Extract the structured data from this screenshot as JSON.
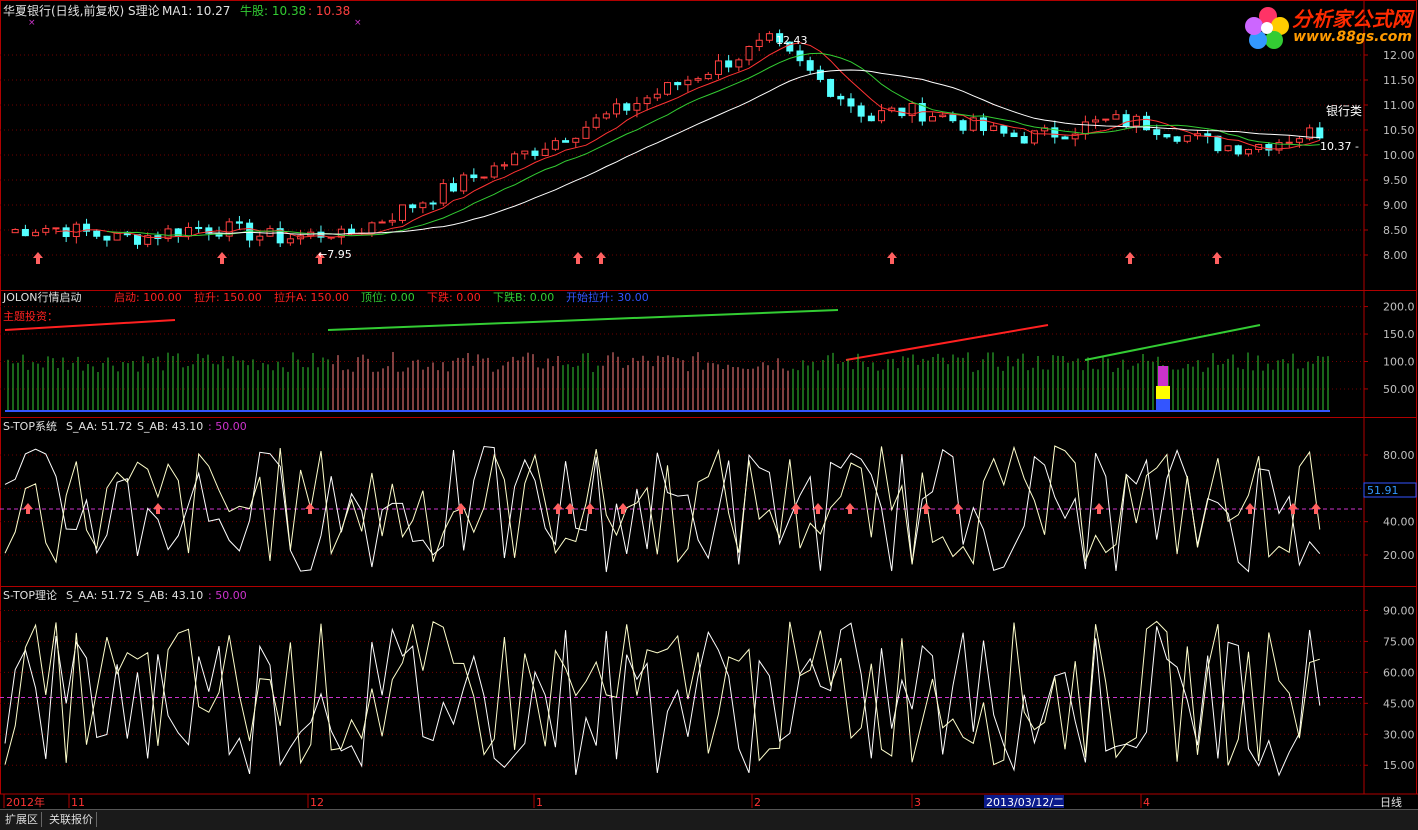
{
  "panels": {
    "main": {
      "title": "华夏银行(日线,前复权) S理论",
      "ma_label": "MA1: 10.27",
      "bull_label": "牛股: 10.38",
      "bull_value2": ": 10.38",
      "right_label": "银行类",
      "price_tag": "10.37",
      "high_label": "12.43",
      "low_label": "7.95",
      "ticks": [
        "12.00",
        "11.50",
        "11.00",
        "10.50",
        "10.00",
        "9.50",
        "9.00",
        "8.50",
        "8.00"
      ]
    },
    "jolon": {
      "title": "JOLON行情启动",
      "items": [
        {
          "text": "启动: 100.00",
          "color": "#ff2020"
        },
        {
          "text": "拉升: 150.00",
          "color": "#ff2020"
        },
        {
          "text": "拉升A: 150.00",
          "color": "#ff2020"
        },
        {
          "text": "顶位: 0.00",
          "color": "#33cc33"
        },
        {
          "text": "下跌: 0.00",
          "color": "#ff2020"
        },
        {
          "text": "下跌B: 0.00",
          "color": "#33cc33"
        },
        {
          "text": "开始拉升: 30.00",
          "color": "#3355ff"
        }
      ],
      "subtitle": "主题投资：",
      "ticks": [
        "200.0",
        "150.0",
        "100.0",
        "50.00"
      ]
    },
    "stop1": {
      "title": "S-TOP系统",
      "saa": "S_AA: 51.72",
      "sab": "S_AB: 43.10",
      "level": ": 50.00",
      "value_tag": "51.91",
      "ticks": [
        "80.00",
        "60.00",
        "40.00",
        "20.00"
      ]
    },
    "stop2": {
      "title": "S-TOP理论",
      "saa": "S_AA: 51.72",
      "sab": "S_AB: 43.10",
      "level": ": 50.00",
      "ticks": [
        "90.00",
        "75.00",
        "60.00",
        "45.00",
        "30.00",
        "15.00"
      ]
    }
  },
  "time_axis": {
    "labels": [
      "2012年",
      "11",
      "12",
      "1",
      "2",
      "3",
      "4"
    ],
    "cursor_date": "2013/03/12/二",
    "period": "日线"
  },
  "logo": {
    "name": "分析家公式网",
    "url": "www.88gs.com"
  },
  "tabs": [
    "扩展区",
    "关联报价"
  ],
  "colors": {
    "background": "#000000",
    "up_candle": "#ff4040",
    "down_candle": "#55ffff",
    "ma_white": "#ffffff",
    "frame": "#b00000"
  }
}
